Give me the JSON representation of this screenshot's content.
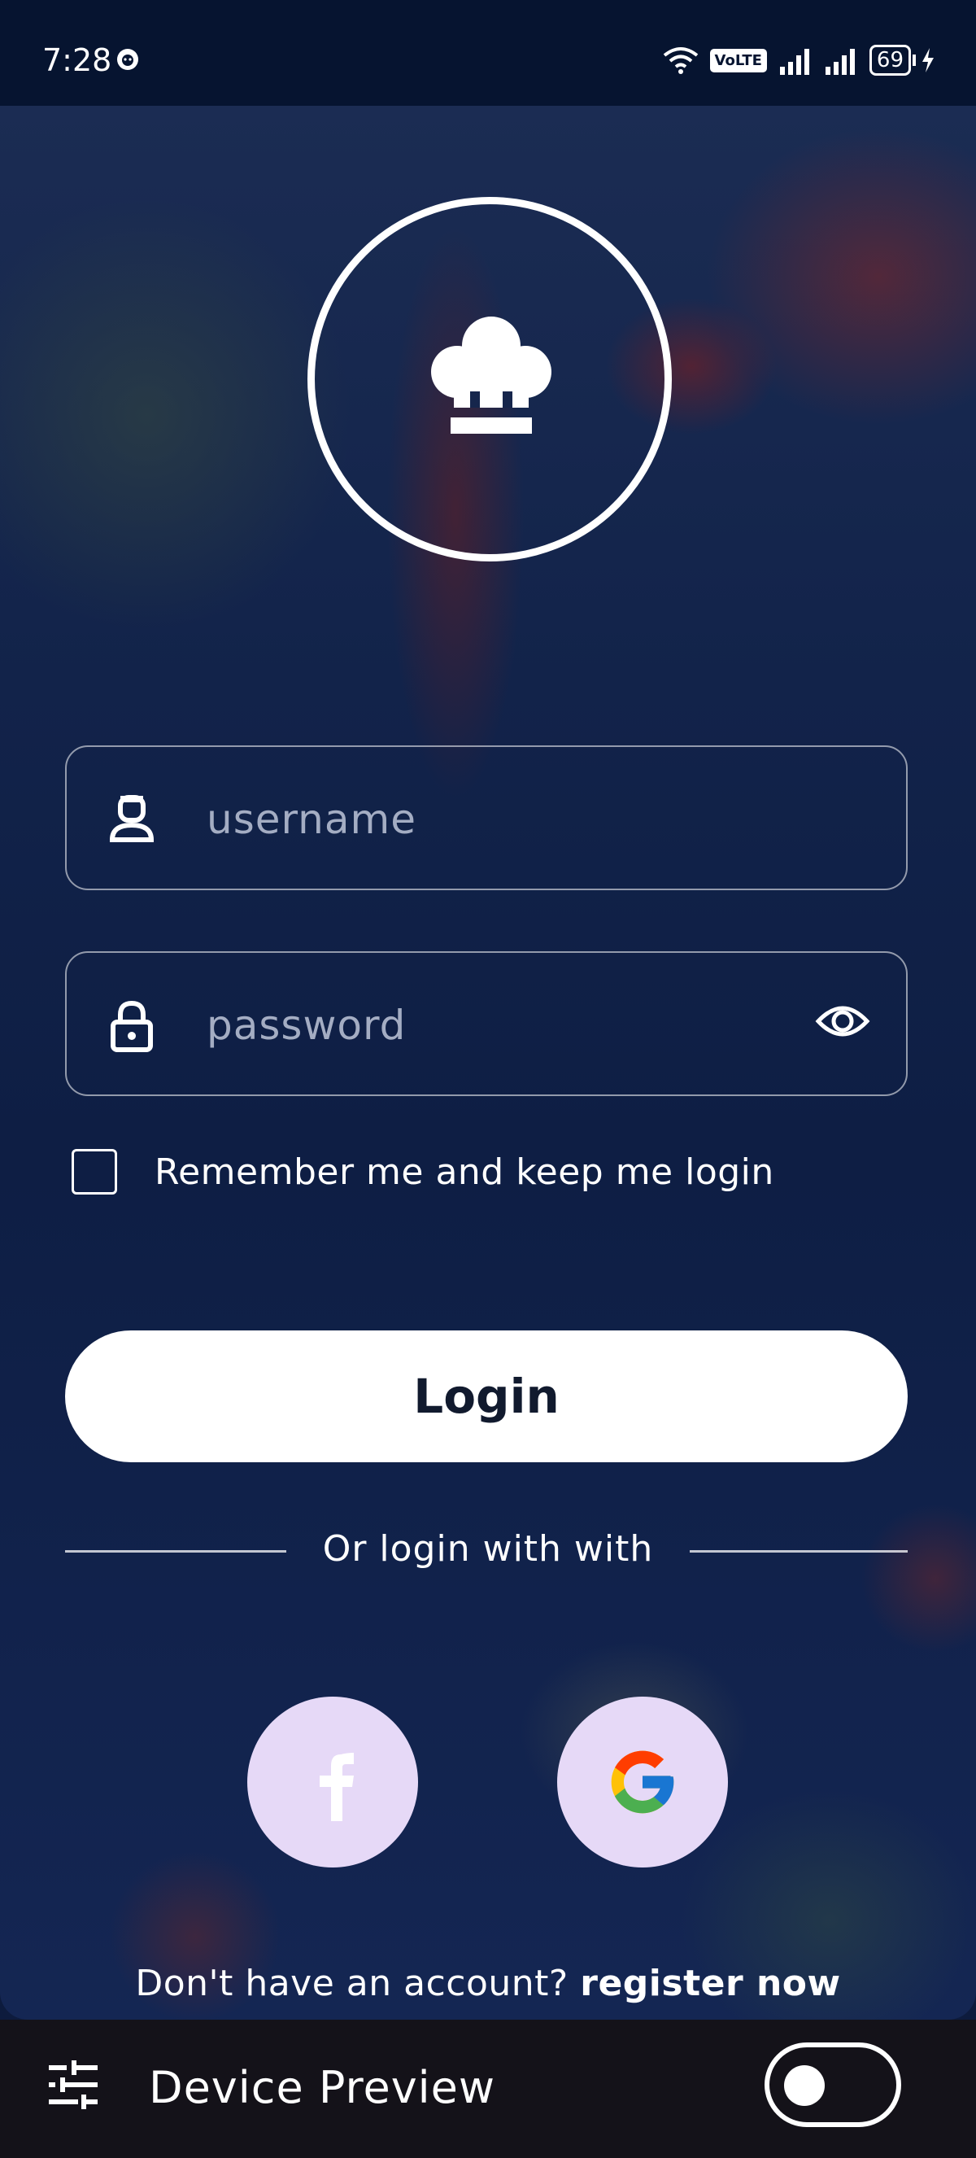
{
  "status_bar": {
    "time": "7:28",
    "network_badge": "VoLTE",
    "battery_level": "69"
  },
  "login": {
    "username_placeholder": "username",
    "password_placeholder": "password",
    "remember_label": "Remember me and keep me login",
    "login_button": "Login",
    "or_text": "Or login with with",
    "register_prompt": "Don't have an account?",
    "register_link": "register now"
  },
  "social": [
    {
      "name": "facebook-icon"
    },
    {
      "name": "google-icon"
    }
  ],
  "device_preview": {
    "title": "Device Preview",
    "toggle_on": false
  },
  "colors": {
    "background": "#12234a",
    "status_bar": "#061430",
    "social_button": "#e6d9f7",
    "preview_bar": "#141219",
    "button_text": "#111a2e"
  }
}
